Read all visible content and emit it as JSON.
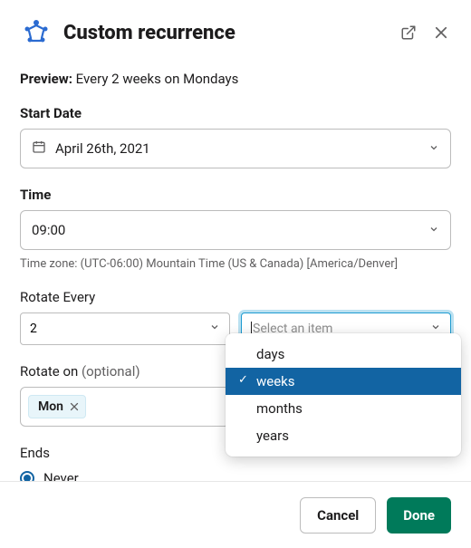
{
  "header": {
    "title": "Custom recurrence"
  },
  "preview": {
    "label": "Preview:",
    "text": "Every 2 weeks on Mondays"
  },
  "startDate": {
    "label": "Start Date",
    "value": "April 26th, 2021"
  },
  "time": {
    "label": "Time",
    "value": "09:00",
    "timezone": "Time zone: (UTC-06:00) Mountain Time (US & Canada)  [America/Denver]"
  },
  "rotateEvery": {
    "label": "Rotate Every",
    "count": "2",
    "unitPlaceholder": "Select an item",
    "options": [
      "days",
      "weeks",
      "months",
      "years"
    ],
    "selected": "weeks"
  },
  "rotateOn": {
    "label": "Rotate on",
    "optional": "(optional)",
    "chip": "Mon"
  },
  "ends": {
    "label": "Ends",
    "option": "Never"
  },
  "footer": {
    "cancel": "Cancel",
    "done": "Done"
  }
}
